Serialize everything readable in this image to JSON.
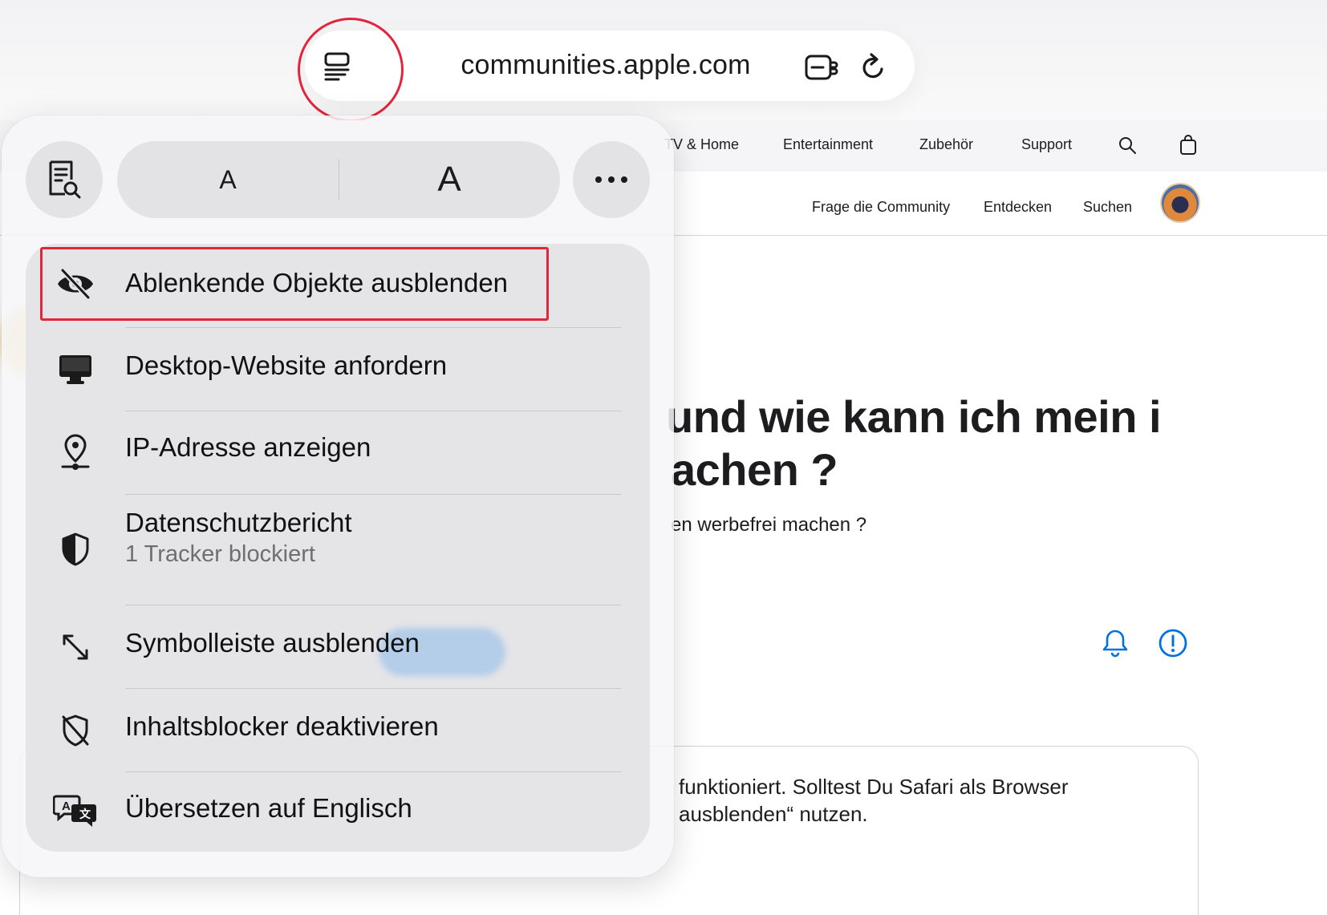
{
  "browser": {
    "url": "communities.apple.com",
    "reader_icon": "page-menu-icon",
    "extension_icon": "extension-icon",
    "reload_icon": "reload-icon"
  },
  "site_nav": {
    "items": [
      "TV & Home",
      "Entertainment",
      "Zubehör",
      "Support"
    ],
    "search_icon": "search-icon",
    "bag_icon": "bag-icon"
  },
  "community_nav": {
    "items": [
      "Frage die Community",
      "Entdecken",
      "Suchen"
    ]
  },
  "page": {
    "headline_line1": "und wie kann ich mein i",
    "headline_line2": "achen ?",
    "subline": "en werbefrei machen ?",
    "answer_line1": "funktioniert. Solltest Du Safari als Browser",
    "answer_line2": "ausblenden“ nutzen."
  },
  "popover": {
    "font_small": "A",
    "font_large": "A",
    "menu": [
      {
        "label": "Ablenkende Objekte ausblenden",
        "icon": "eye-slash-icon"
      },
      {
        "label": "Desktop-Website anfordern",
        "icon": "desktop-icon"
      },
      {
        "label": "IP-Adresse anzeigen",
        "icon": "location-pin-icon"
      },
      {
        "label": "Datenschutzbericht",
        "sublabel": "1 Tracker blockiert",
        "icon": "privacy-shield-icon"
      },
      {
        "label": "Symbolleiste ausblenden",
        "icon": "resize-arrows-icon"
      },
      {
        "label": "Inhaltsblocker deaktivieren",
        "icon": "shield-slash-icon"
      },
      {
        "label": "Übersetzen auf Englisch",
        "icon": "translate-icon"
      }
    ]
  },
  "colors": {
    "highlight": "#e3243b",
    "accent_blue": "#0071e3",
    "popover_bg": "#f6f6f8",
    "menu_bg": "#e5e5e8"
  }
}
